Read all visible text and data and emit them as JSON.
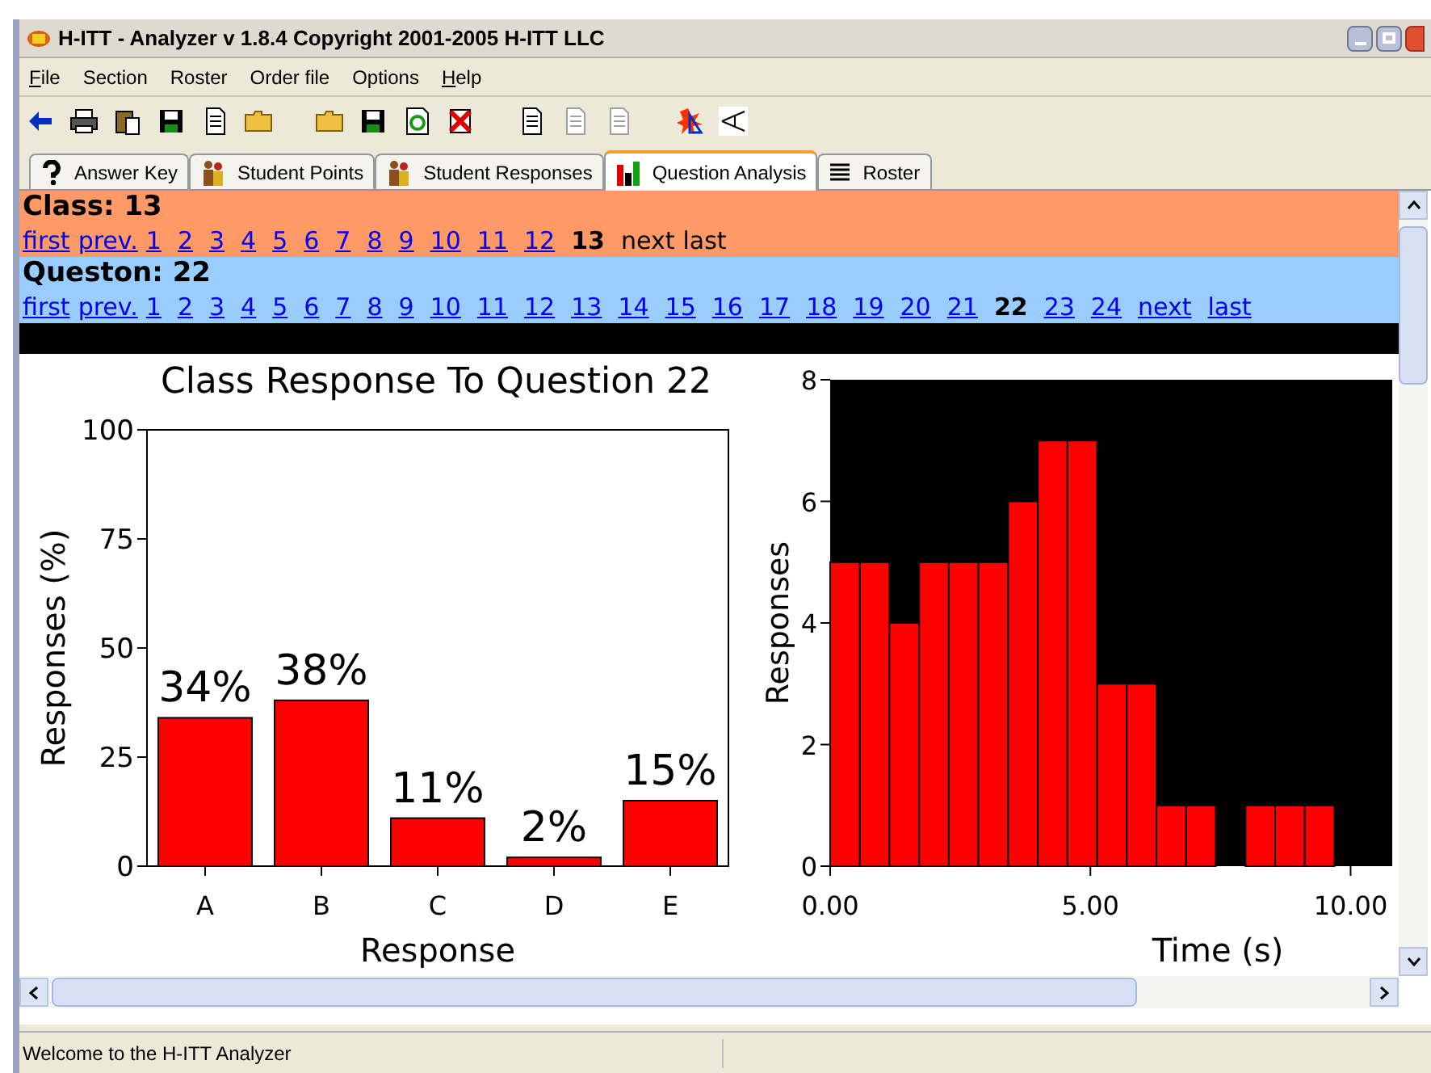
{
  "window": {
    "title": "H-ITT - Analyzer v 1.8.4 Copyright 2001-2005 H-ITT LLC"
  },
  "menu": [
    {
      "label": "File",
      "mnemonic": true
    },
    {
      "label": "Section",
      "mnemonic": false
    },
    {
      "label": "Roster",
      "mnemonic": false
    },
    {
      "label": "Order file",
      "mnemonic": false
    },
    {
      "label": "Options",
      "mnemonic": false
    },
    {
      "label": "Help",
      "mnemonic": true
    }
  ],
  "toolbar": [
    {
      "kind": "back",
      "disabled": false
    },
    {
      "kind": "printer",
      "disabled": false
    },
    {
      "kind": "clipboard",
      "disabled": false
    },
    {
      "kind": "disk",
      "disabled": false
    },
    {
      "kind": "page",
      "disabled": false
    },
    {
      "kind": "folder",
      "disabled": false
    },
    {
      "kind": "gap"
    },
    {
      "kind": "folder",
      "disabled": false
    },
    {
      "kind": "disk",
      "disabled": false
    },
    {
      "kind": "refresh",
      "disabled": false
    },
    {
      "kind": "cross",
      "disabled": false
    },
    {
      "kind": "gap"
    },
    {
      "kind": "page",
      "disabled": false
    },
    {
      "kind": "page",
      "disabled": true
    },
    {
      "kind": "page",
      "disabled": true
    },
    {
      "kind": "gap"
    },
    {
      "kind": "burst",
      "disabled": false
    },
    {
      "kind": "angle",
      "disabled": false
    }
  ],
  "tabs": [
    {
      "label": "Answer Key",
      "selected": false
    },
    {
      "label": "Student Points",
      "selected": false
    },
    {
      "label": "Student Responses",
      "selected": false
    },
    {
      "label": "Question Analysis",
      "selected": true
    },
    {
      "label": "Roster",
      "selected": false
    }
  ],
  "class_section": {
    "heading": "Class: 13",
    "nav": [
      {
        "label": "first",
        "kind": "link"
      },
      {
        "label": "prev.",
        "kind": "link"
      },
      {
        "label": "1",
        "kind": "link"
      },
      {
        "label": "2",
        "kind": "link"
      },
      {
        "label": "3",
        "kind": "link"
      },
      {
        "label": "4",
        "kind": "link"
      },
      {
        "label": "5",
        "kind": "link"
      },
      {
        "label": "6",
        "kind": "link"
      },
      {
        "label": "7",
        "kind": "link"
      },
      {
        "label": "8",
        "kind": "link"
      },
      {
        "label": "9",
        "kind": "link"
      },
      {
        "label": "10",
        "kind": "link"
      },
      {
        "label": "11",
        "kind": "link"
      },
      {
        "label": "12",
        "kind": "link"
      },
      {
        "label": "13",
        "kind": "current"
      },
      {
        "label": "next",
        "kind": "plain"
      },
      {
        "label": "last",
        "kind": "plain"
      }
    ]
  },
  "question_section": {
    "heading": "Queston: 22",
    "nav": [
      {
        "label": "first",
        "kind": "link"
      },
      {
        "label": "prev.",
        "kind": "link"
      },
      {
        "label": "1",
        "kind": "link"
      },
      {
        "label": "2",
        "kind": "link"
      },
      {
        "label": "3",
        "kind": "link"
      },
      {
        "label": "4",
        "kind": "link"
      },
      {
        "label": "5",
        "kind": "link"
      },
      {
        "label": "6",
        "kind": "link"
      },
      {
        "label": "7",
        "kind": "link"
      },
      {
        "label": "8",
        "kind": "link"
      },
      {
        "label": "9",
        "kind": "link"
      },
      {
        "label": "10",
        "kind": "link"
      },
      {
        "label": "11",
        "kind": "link"
      },
      {
        "label": "12",
        "kind": "link"
      },
      {
        "label": "13",
        "kind": "link"
      },
      {
        "label": "14",
        "kind": "link"
      },
      {
        "label": "15",
        "kind": "link"
      },
      {
        "label": "16",
        "kind": "link"
      },
      {
        "label": "17",
        "kind": "link"
      },
      {
        "label": "18",
        "kind": "link"
      },
      {
        "label": "19",
        "kind": "link"
      },
      {
        "label": "20",
        "kind": "link"
      },
      {
        "label": "21",
        "kind": "link"
      },
      {
        "label": "22",
        "kind": "current"
      },
      {
        "label": "23",
        "kind": "link"
      },
      {
        "label": "24",
        "kind": "link"
      },
      {
        "label": "next",
        "kind": "link"
      },
      {
        "label": "last",
        "kind": "link"
      }
    ]
  },
  "response_chart": {
    "chart_data": {
      "type": "bar",
      "title": "Class Response To Question 22",
      "xlabel": "Response",
      "ylabel": "Responses (%)",
      "categories": [
        "A",
        "B",
        "C",
        "D",
        "E"
      ],
      "values": [
        34,
        38,
        11,
        2,
        15
      ],
      "ylim": [
        0,
        100
      ],
      "yticks": [
        0,
        25,
        50,
        75,
        100
      ],
      "value_labels": [
        "34%",
        "38%",
        "11%",
        "2%",
        "15%"
      ]
    }
  },
  "time_chart": {
    "chart_data": {
      "type": "bar",
      "xlabel": "Time (s)",
      "ylabel": "Responses",
      "x": [
        0.285,
        0.855,
        1.425,
        1.995,
        2.565,
        3.135,
        3.705,
        4.275,
        4.845,
        5.415,
        5.985,
        6.555,
        7.125,
        7.695,
        8.265,
        8.835,
        9.405
      ],
      "values": [
        5,
        5,
        4,
        5,
        5,
        5,
        6,
        7,
        7,
        3,
        3,
        1,
        1,
        0,
        1,
        1,
        1
      ],
      "xlim": [
        0,
        10.8
      ],
      "ylim": [
        0,
        8
      ],
      "xticks": [
        {
          "value": 0,
          "label": "0.00"
        },
        {
          "value": 5,
          "label": "5.00"
        },
        {
          "value": 10,
          "label": "10.00"
        }
      ],
      "yticks": [
        0,
        2,
        4,
        6,
        8
      ]
    }
  },
  "status_bar": {
    "text": "Welcome to the H-ITT Analyzer"
  }
}
